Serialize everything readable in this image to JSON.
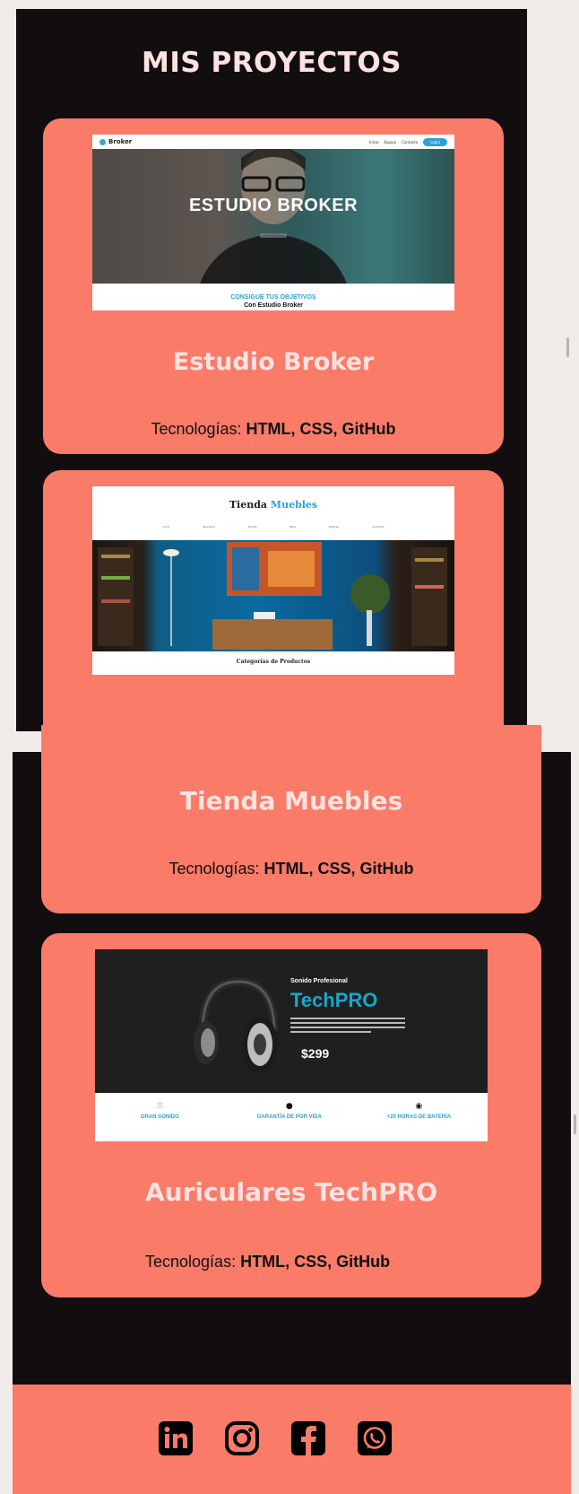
{
  "section_title": "MIS PROYECTOS",
  "tech_prefix": "Tecnologías:",
  "projects": [
    {
      "title": "Estudio Broker",
      "technologies": "HTML, CSS, GitHub",
      "preview": {
        "brand": "Broker",
        "nav": [
          "Inicio",
          "Equipo",
          "Contacto"
        ],
        "nav_button": "Login",
        "hero_title": "ESTUDIO BROKER",
        "tagline": "CONSIGUE TUS OBJETIVOS",
        "subtagline": "Con Estudio Broker"
      }
    },
    {
      "title": "Tienda Muebles",
      "technologies": "HTML, CSS, GitHub",
      "preview": {
        "brand_part1": "Tienda",
        "brand_part2": "Muebles",
        "nav": [
          "Inicio",
          "Nosotros",
          "Tienda",
          "Blog",
          "Ofertas",
          "Contacto"
        ],
        "section": "Categorías de Productos"
      }
    },
    {
      "title": "Auriculares TechPRO",
      "technologies": "HTML, CSS, GitHub",
      "preview": {
        "kicker": "Sonido Profesional",
        "brand": "TechPRO",
        "price": "$299",
        "features": [
          "GRAN SONIDO",
          "GARANTÍA DE POR VIDA",
          "+20 HORAS DE BATERÍA"
        ]
      }
    }
  ],
  "social_icons": [
    "linkedin-icon",
    "instagram-icon",
    "facebook-icon",
    "whatsapp-icon"
  ],
  "colors": {
    "accent": "#fa7b68",
    "background": "#120e10",
    "heading": "#fde2e1",
    "techpro_gradient": "#1aa6c9"
  }
}
